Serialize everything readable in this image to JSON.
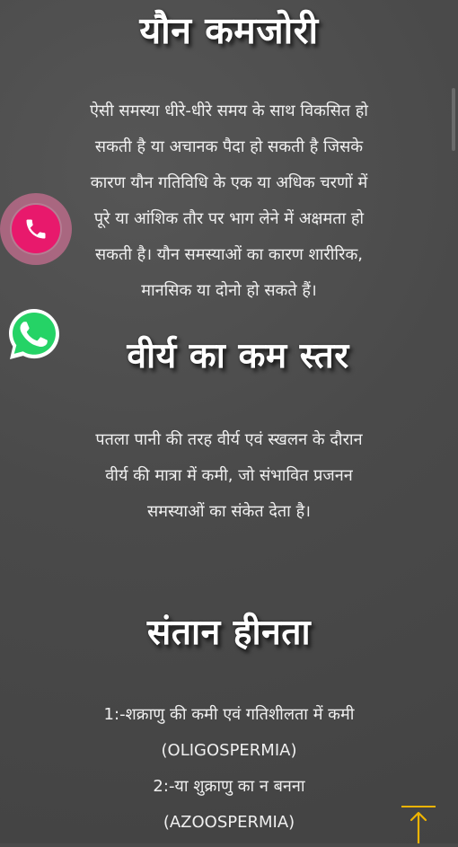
{
  "sections": [
    {
      "title": "यौन कमजोरी",
      "lines": [
        "ऐसी समस्या धीरे-धीरे समय के साथ विकसित हो",
        "सकती है या अचानक पैदा हो सकती है जिसके",
        "कारण यौन गतिविधि के एक या अधिक चरणों में",
        "पूरे या आंशिक तौर पर भाग लेने में अक्षमता हो",
        "सकती है। यौन समस्याओं का कारण शारीरिक,",
        "मानसिक या दोनो हो सकते हैं।"
      ]
    },
    {
      "title": "वीर्य का कम स्तर",
      "lines": [
        "पतला पानी की तरह वीर्य एवं स्खलन के दौरान",
        "वीर्य की मात्रा में कमी, जो संभावित प्रजनन",
        "समस्याओं का संकेत देता है।"
      ]
    },
    {
      "title": "संतान हीनता",
      "lines": [
        "1:-शक्राणु की कमी एवं गतिशीलता में कमी",
        "(OLIGOSPERMIA)",
        "2:-या शुक्राणु का न बनना",
        "(AZOOSPERMIA)"
      ]
    }
  ],
  "floating": {
    "call_icon": "phone-icon",
    "whatsapp_icon": "whatsapp-icon",
    "scroll_top_icon": "arrow-up-icon"
  },
  "colors": {
    "background": "#4a4a4a",
    "call_button": "#e8196c",
    "whatsapp": "#25d366",
    "scroll_top": "#f0b400"
  }
}
